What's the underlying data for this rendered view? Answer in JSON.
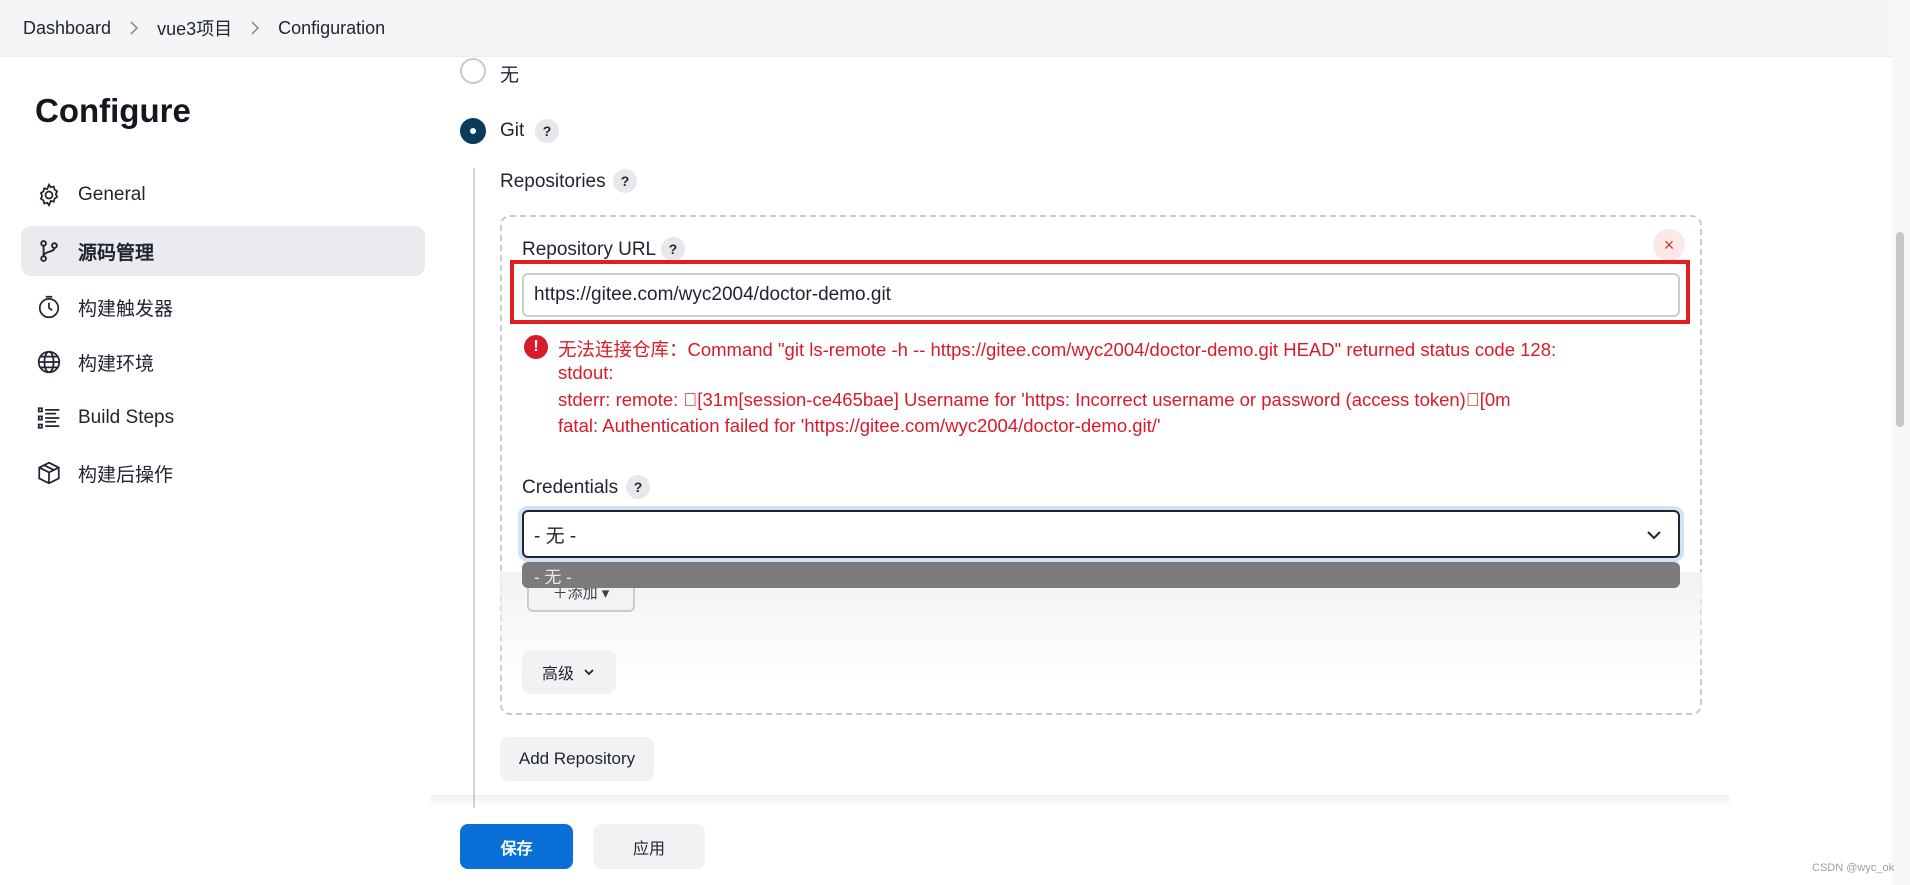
{
  "breadcrumb": {
    "items": [
      "Dashboard",
      "vue3项目",
      "Configuration"
    ]
  },
  "sidebar": {
    "title": "Configure",
    "items": [
      {
        "label": "General",
        "icon": "gear-icon"
      },
      {
        "label": "源码管理",
        "icon": "branch-icon",
        "active": true
      },
      {
        "label": "构建触发器",
        "icon": "clock-icon"
      },
      {
        "label": "构建环境",
        "icon": "globe-icon"
      },
      {
        "label": "Build Steps",
        "icon": "list-icon"
      },
      {
        "label": "构建后操作",
        "icon": "package-icon"
      }
    ]
  },
  "scm": {
    "option_none": "无",
    "option_git": "Git",
    "help": "?",
    "repositories_label": "Repositories",
    "repo_url_label": "Repository URL",
    "repo_url_value": "https://gitee.com/wyc2004/doctor-demo.git",
    "error_icon": "!",
    "error_lines": [
      "无法连接仓库：Command \"git ls-remote -h -- https://gitee.com/wyc2004/doctor-demo.git HEAD\" returned status code 128:",
      "stdout:",
      "stderr: remote: \u0000[31m[session-ce465bae] Username for 'https: Incorrect username or password (access token)\u0000[0m",
      "fatal: Authentication failed for 'https://gitee.com/wyc2004/doctor-demo.git/'"
    ],
    "credentials_label": "Credentials",
    "credentials_selected": "- 无 -",
    "credentials_options": [
      "- 无 -"
    ],
    "add_label": "＋添加 ▾",
    "advanced_label": "高级",
    "add_repository_label": "Add Repository",
    "close_label": "×"
  },
  "footer": {
    "save_label": "保存",
    "apply_label": "应用"
  },
  "watermark": "CSDN @wyc_ok",
  "colors": {
    "accent": "#0a6fd6",
    "error": "#d81b2a",
    "highlight": "#e02020",
    "radio_checked": "#0b3a5d"
  }
}
